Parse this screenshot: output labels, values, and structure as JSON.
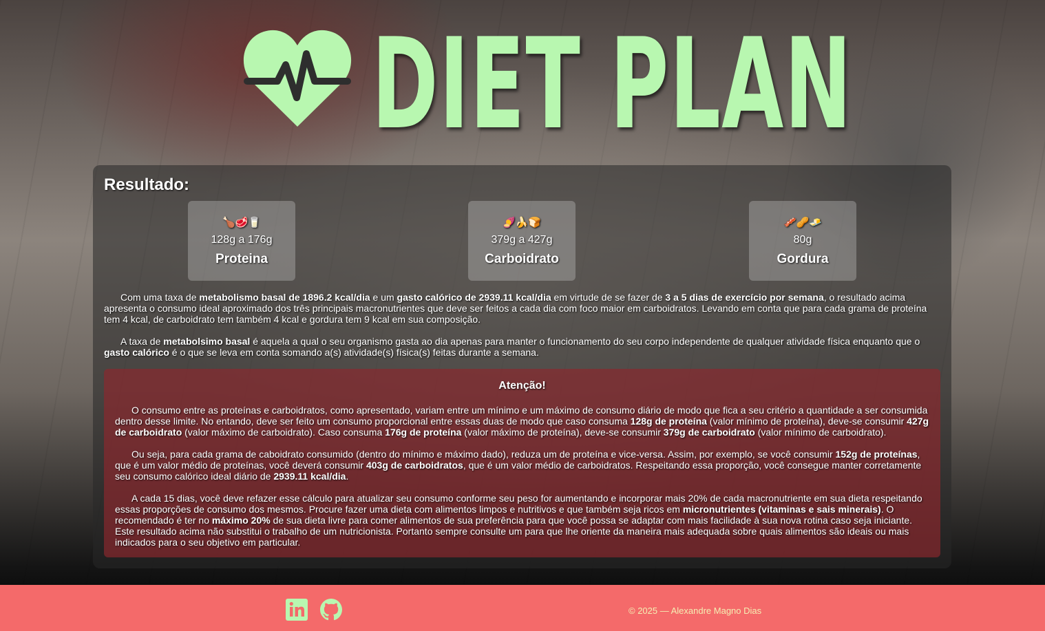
{
  "header": {
    "logo_icon": "heart-pulse-icon",
    "title": "DIET PLAN",
    "accent_color": "#b8f7b0"
  },
  "result": {
    "title": "Resultado:",
    "macros": [
      {
        "emoji": "🍗🥩🥛",
        "range": "128g a 176g",
        "name": "Proteina"
      },
      {
        "emoji": "🍠🍌🍞",
        "range": "379g a 427g",
        "name": "Carboidrato"
      },
      {
        "emoji": "🥓🥜🧈",
        "range": "80g",
        "name": "Gordura"
      }
    ],
    "para1": {
      "t1": "Com uma taxa de ",
      "b1": "metabolismo basal de 1896.2 kcal/dia",
      "t2": " e um ",
      "b2": "gasto calórico de 2939.11 kcal/dia",
      "t3": " em virtude de se fazer de ",
      "b3": "3 a 5 dias de exercício por semana",
      "t4": ", o resultado acima apresenta o consumo ideal aproximado dos três principais macronutrientes que deve ser feitos a cada dia com foco maior em carboidratos. Levando em conta que para cada grama de proteína tem 4 kcal, de carboidrato tem também 4 kcal e gordura tem 9 kcal em sua composição."
    },
    "para2": {
      "t1": "A taxa de ",
      "b1": "metabolsimo basal",
      "t2": " é aquela a qual o seu organismo gasta ao dia apenas para manter o funcionamento do seu corpo independente de qualquer atividade física enquanto que o ",
      "b2": "gasto calórico",
      "t3": " é o que se leva em conta somando a(s) atividade(s) física(s) feitas durante a semana."
    }
  },
  "warning": {
    "title": "Atenção!",
    "p1": {
      "t1": "O consumo entre as proteínas e carboidratos, como apresentado, variam entre um mínimo e um máximo de consumo diário de modo que fica a seu critério a quantidade a ser consumida dentro desse limite. No entando, deve ser feito um consumo proporcional entre essas duas de modo que caso consuma ",
      "b1": "128g de proteína",
      "t2": " (valor mínimo de proteína), deve-se consumir ",
      "b2": "427g de carboidrato",
      "t3": " (valor máximo de carboidrato). Caso consuma ",
      "b3": "176g de proteína",
      "t4": " (valor máximo de proteína), deve-se consumir ",
      "b4": "379g de carboidrato",
      "t5": " (valor mínimo de carboidrato)."
    },
    "p2": {
      "t1": "Ou seja, para cada grama de caboidrato consumido (dentro do mínimo e máximo dado), reduza um de proteína e vice-versa. Assim, por exemplo, se você consumir ",
      "b1": "152g de proteínas",
      "t2": ", que é um valor médio de proteínas, você deverá consumir ",
      "b2": "403g de carboidratos",
      "t3": ", que é um valor médio de carboidratos. Respeitando essa proporção, você consegue manter corretamente seu consumo calórico ideal diário de ",
      "b3": "2939.11 kcal/dia",
      "t4": "."
    },
    "p3": {
      "t1": "A cada 15 dias, você deve refazer esse cálculo para atualizar seu consumo conforme seu peso for aumentando e incorporar mais 20% de cada macronutriente em sua dieta respeitando essas proporções de consumo dos mesmos. Procure fazer uma dieta com alimentos limpos e nutritivos e que também seja ricos em ",
      "b1": "micronutrientes (vitaminas e sais minerais)",
      "t2": ". O recomendado é ter no ",
      "b2": "máximo 20%",
      "t3": " de sua dieta livre para comer alimentos de sua preferência para que você possa se adaptar com mais facilidade à sua nova rotina caso seja iniciante. Este resultado acima não substitui o trabalho de um nutricionista. Portanto sempre consulte um para que lhe oriente da maneira mais adequada sobre quais alimentos são ideais ou mais indicados para o seu objetivo em particular."
    }
  },
  "footer": {
    "linkedin_icon": "linkedin-icon",
    "github_icon": "github-icon",
    "copyright": "© 2025 — Alexandre Magno Dias",
    "background_color": "#f46a6a"
  }
}
